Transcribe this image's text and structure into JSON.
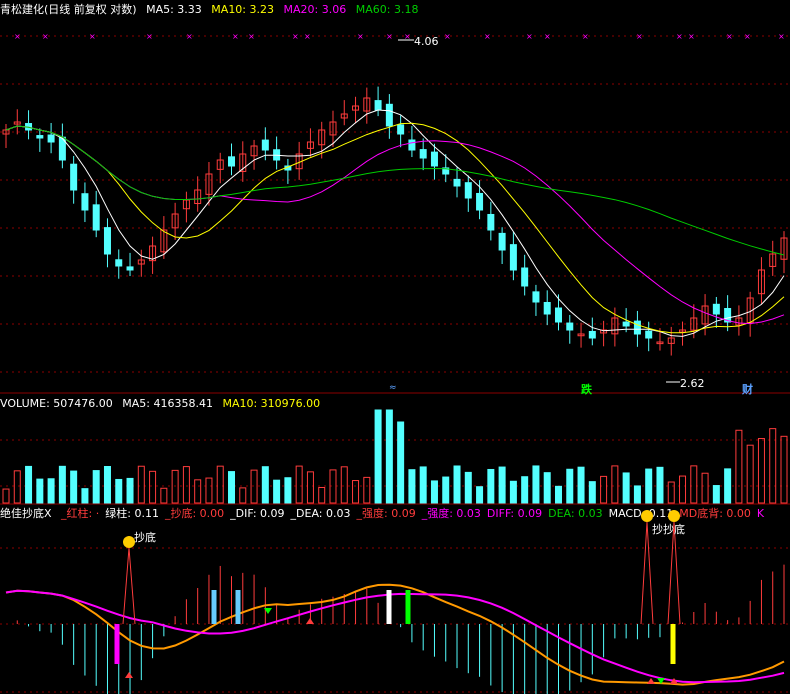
{
  "colors": {
    "bg": "#000000",
    "up": "#ff3c3c",
    "down": "#54ffff",
    "ma5": "#ffffff",
    "ma10": "#ffff00",
    "ma20": "#ff00ff",
    "ma60": "#00cc00",
    "grid": "#8b0000"
  },
  "price_panel": {
    "title": "青松建化(日线 前复权 对数)",
    "ma5_label": "MA5: 3.33",
    "ma10_label": "MA10: 3.23",
    "ma20_label": "MA20: 3.06",
    "ma60_label": "MA60: 3.18",
    "high_label": "4.06",
    "low_label": "2.62",
    "event_die": "跌",
    "event_cai": "财",
    "event_arrow": "≈"
  },
  "volume_panel": {
    "volume_label": "VOLUME: 507476.00",
    "ma5_label": "MA5: 416358.41",
    "ma10_label": "MA10: 310976.00"
  },
  "indicator_panel": {
    "name": "绝佳抄底X",
    "items": [
      {
        "text": "_红柱: ·",
        "color": "#ff3c3c"
      },
      {
        "text": "绿柱: 0.11",
        "color": "#ffffff"
      },
      {
        "text": "_抄底: 0.00",
        "color": "#ff3c3c"
      },
      {
        "text": "_DIF: 0.09",
        "color": "#ffffff"
      },
      {
        "text": "_DEA: 0.03",
        "color": "#ffffff"
      },
      {
        "text": "_强度: 0.09",
        "color": "#ff3c3c"
      },
      {
        "text": "_强度: 0.03",
        "color": "#ff00ff"
      },
      {
        "text": "DIFF: 0.09",
        "color": "#ff00ff"
      },
      {
        "text": "DEA: 0.03",
        "color": "#00cc00"
      },
      {
        "text": "MACD: 0.11",
        "color": "#ffffff"
      },
      {
        "text": "MD底背: 0.00",
        "color": "#ff3c3c"
      },
      {
        "text": "K",
        "color": "#ff00ff"
      }
    ],
    "signal_label_1": "抄底",
    "signal_label_2": "抄抄底"
  },
  "chart_data": {
    "type": "candlestick",
    "close": [
      3.7,
      3.74,
      3.7,
      3.66,
      3.64,
      3.55,
      3.4,
      3.3,
      3.2,
      3.08,
      3.02,
      3.0,
      3.05,
      3.12,
      3.2,
      3.28,
      3.35,
      3.4,
      3.48,
      3.55,
      3.52,
      3.58,
      3.62,
      3.6,
      3.55,
      3.5,
      3.58,
      3.64,
      3.7,
      3.74,
      3.78,
      3.82,
      3.86,
      3.8,
      3.72,
      3.68,
      3.6,
      3.56,
      3.52,
      3.48,
      3.42,
      3.36,
      3.3,
      3.2,
      3.1,
      3.0,
      2.92,
      2.84,
      2.78,
      2.74,
      2.7,
      2.68,
      2.66,
      2.7,
      2.76,
      2.72,
      2.68,
      2.66,
      2.64,
      2.66,
      2.7,
      2.76,
      2.82,
      2.78,
      2.74,
      2.76,
      2.86,
      3.0,
      3.08,
      3.16
    ],
    "high_label_value": 4.06,
    "low_label_value": 2.62
  }
}
